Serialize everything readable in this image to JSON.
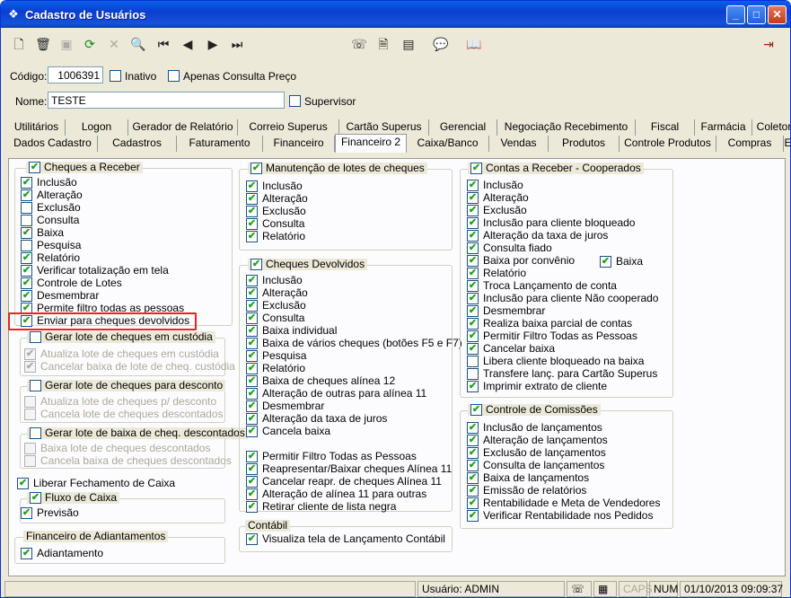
{
  "window": {
    "title": "Cadastro de Usuários"
  },
  "toolbar": {
    "icons": [
      "new-icon",
      "delete-icon",
      "save-icon",
      "refresh-icon",
      "cancel-icon",
      "search-icon",
      "first-icon",
      "prev-icon",
      "next-icon",
      "last-icon",
      "phone-icon",
      "add-doc-icon",
      "list-icon",
      "chat-icon",
      "book-icon",
      "exit-icon"
    ]
  },
  "header": {
    "codigo_label": "Código:",
    "codigo_value": "1006391",
    "inativo": "Inativo",
    "apenas": "Apenas Consulta Preço",
    "nome_label": "Nome:",
    "nome_value": "TESTE",
    "supervisor": "Supervisor"
  },
  "tabs_row1": [
    "Utilitários",
    "Logon",
    "Gerador de Relatório",
    "Correio Superus",
    "Cartão Superus",
    "Gerencial",
    "Negociação Recebimento",
    "Fiscal",
    "Farmácia",
    "Coletor"
  ],
  "tabs_row2": [
    "Dados Cadastro",
    "Cadastros",
    "Faturamento",
    "Financeiro",
    "Financeiro 2",
    "Caixa/Banco",
    "Vendas",
    "Produtos",
    "Controle Produtos",
    "Compras",
    "Estoque"
  ],
  "col1": {
    "cheques_receber": {
      "title": "Cheques a Receber",
      "items": [
        "Inclusão",
        "Alteração",
        "Exclusão",
        "Consulta",
        "Baixa",
        "Pesquisa",
        "Relatório",
        "Verificar totalização em tela",
        "Controle de Lotes",
        "Desmembrar",
        "Permite filtro todas as pessoas",
        "Enviar para cheques devolvidos"
      ],
      "checked": [
        1,
        1,
        0,
        0,
        1,
        0,
        1,
        1,
        1,
        1,
        1,
        1
      ]
    },
    "custodia": {
      "title": "Gerar lote de cheques em custódia",
      "items": [
        "Atualiza lote de cheques em custódia",
        "Cancelar baixa de lote de cheq. custódia"
      ]
    },
    "desconto": {
      "title": "Gerar lote de cheques para desconto",
      "items": [
        "Atualiza lote de cheques p/ desconto",
        "Cancela lote de cheques descontados"
      ]
    },
    "baixa_desc": {
      "title": "Gerar lote de baixa de cheq. descontados",
      "items": [
        "Baixa lote de cheques descontados",
        "Cancela baixa de cheques descontados"
      ]
    },
    "liberar": "Liberar Fechamento de Caixa",
    "fluxo": {
      "title": "Fluxo de Caixa",
      "item": "Previsão"
    },
    "adiant": {
      "title": "Financeiro de Adiantamentos",
      "item": "Adiantamento"
    }
  },
  "col2": {
    "manut": {
      "title": "Manutenção de lotes de cheques",
      "items": [
        "Inclusão",
        "Alteração",
        "Exclusão",
        "Consulta",
        "Relatório"
      ]
    },
    "devolvidos": {
      "title": "Cheques Devolvidos",
      "items": [
        "Inclusão",
        "Alteração",
        "Exclusão",
        "Consulta",
        "Baixa individual",
        "Baixa de vários cheques (botões F5 e F7)",
        "Pesquisa",
        "Relatório",
        "Baixa de cheques alínea 12",
        "Alteração de outras para alínea 11",
        "Desmembrar",
        "Alteração da taxa de juros",
        "Cancela baixa"
      ],
      "items2": [
        "Permitir Filtro Todas as Pessoas",
        "Reapresentar/Baixar cheques Alínea 11",
        "Cancelar reapr. de cheques Alínea 11",
        "Alteração de alínea 11 para outras",
        "Retirar cliente de lista negra"
      ]
    },
    "contabil": {
      "title": "Contábil",
      "item": "Visualiza tela de Lançamento Contábil"
    }
  },
  "col3": {
    "cooperados": {
      "title": "Contas a Receber - Cooperados",
      "items": [
        "Inclusão",
        "Alteração",
        "Exclusão",
        "Inclusão para cliente bloqueado",
        "Alteração da taxa de juros",
        "Consulta fiado",
        "Baixa por convênio",
        "Relatório",
        "Troca Lançamento de conta",
        "Inclusão para cliente Não cooperado",
        "Desmembrar",
        "Realiza baixa parcial de contas",
        "Permitir Filtro Todas as Pessoas",
        "Cancelar baixa",
        "Libera cliente bloqueado na baixa",
        "Transfere lanç. para Cartão Superus",
        "Imprimir extrato de cliente"
      ],
      "checked": [
        1,
        1,
        1,
        1,
        1,
        1,
        1,
        1,
        1,
        1,
        1,
        1,
        1,
        1,
        0,
        0,
        1
      ],
      "baixa": "Baixa"
    },
    "comissoes": {
      "title": "Controle de Comissões",
      "items": [
        "Inclusão de lançamentos",
        "Alteração de lançamentos",
        "Exclusão de lançamentos",
        "Consulta de lançamentos",
        "Baixa de lançamentos",
        "Emissão de relatórios",
        "Rentabilidade e Meta de Vendedores",
        "Verificar Rentabilidade nos Pedidos"
      ]
    }
  },
  "status": {
    "usuario": "Usuário: ADMIN",
    "caps": "CAPS",
    "num": "NUM",
    "datetime": "01/10/2013 09:09:37"
  },
  "check_mark": "✔"
}
